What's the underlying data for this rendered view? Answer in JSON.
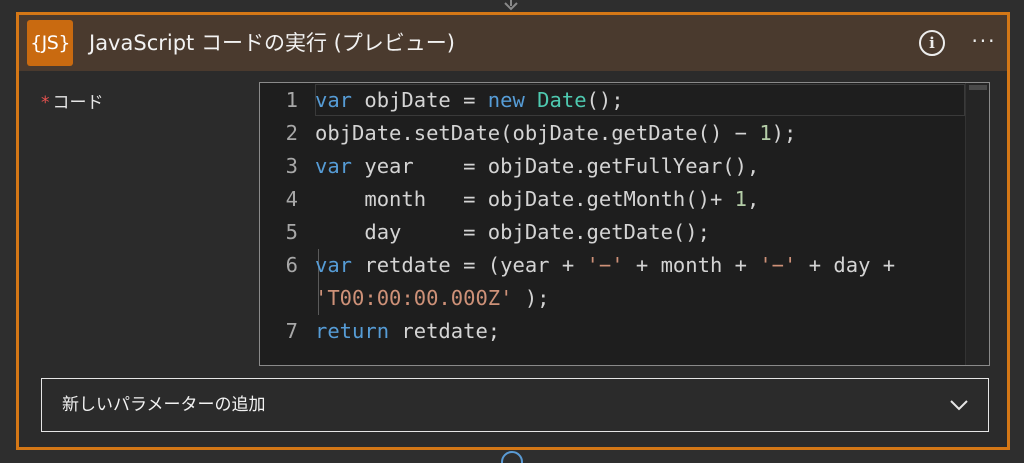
{
  "header": {
    "badge": "{JS}",
    "title": "JavaScript コードの実行 (プレビュー)",
    "info_glyph": "i",
    "more_glyph": "···"
  },
  "code_field": {
    "required_mark": "*",
    "label": "コード"
  },
  "editor": {
    "lines": [
      {
        "num": "1",
        "tokens": [
          [
            "kw",
            "var"
          ],
          [
            "t",
            " objDate = "
          ],
          [
            "kw",
            "new"
          ],
          [
            "t",
            " "
          ],
          [
            "cls",
            "Date"
          ],
          [
            "t",
            "();"
          ]
        ]
      },
      {
        "num": "2",
        "tokens": [
          [
            "t",
            "objDate.setDate(objDate.getDate() − "
          ],
          [
            "num",
            "1"
          ],
          [
            "t",
            ");"
          ]
        ]
      },
      {
        "num": "3",
        "tokens": [
          [
            "kw",
            "var"
          ],
          [
            "t",
            " year    = objDate.getFullYear(),"
          ]
        ]
      },
      {
        "num": "4",
        "tokens": [
          [
            "t",
            "    month   = objDate.getMonth()+ "
          ],
          [
            "num",
            "1"
          ],
          [
            "t",
            ","
          ]
        ]
      },
      {
        "num": "5",
        "tokens": [
          [
            "t",
            "    day     = objDate.getDate();"
          ]
        ]
      },
      {
        "num": "6",
        "tokens": [
          [
            "kw",
            "var"
          ],
          [
            "t",
            " retdate = (year + "
          ],
          [
            "str",
            "'−'"
          ],
          [
            "t",
            " + month + "
          ],
          [
            "str",
            "'−'"
          ],
          [
            "t",
            " + day +"
          ]
        ]
      },
      {
        "num": "",
        "tokens": [
          [
            "str",
            "'T00:00:00.000Z'"
          ],
          [
            "t",
            " );"
          ]
        ]
      },
      {
        "num": "7",
        "tokens": [
          [
            "kw",
            "return"
          ],
          [
            "t",
            " retdate;"
          ]
        ]
      }
    ]
  },
  "params": {
    "label": "新しいパラメーターの追加"
  },
  "colors": {
    "accent_border": "#d47716",
    "header_bg": "#4a3a2e",
    "badge_bg": "#c96a10",
    "keyword": "#569cd6",
    "type": "#4ec9b0",
    "number": "#b5cea8",
    "string": "#ce9178"
  }
}
